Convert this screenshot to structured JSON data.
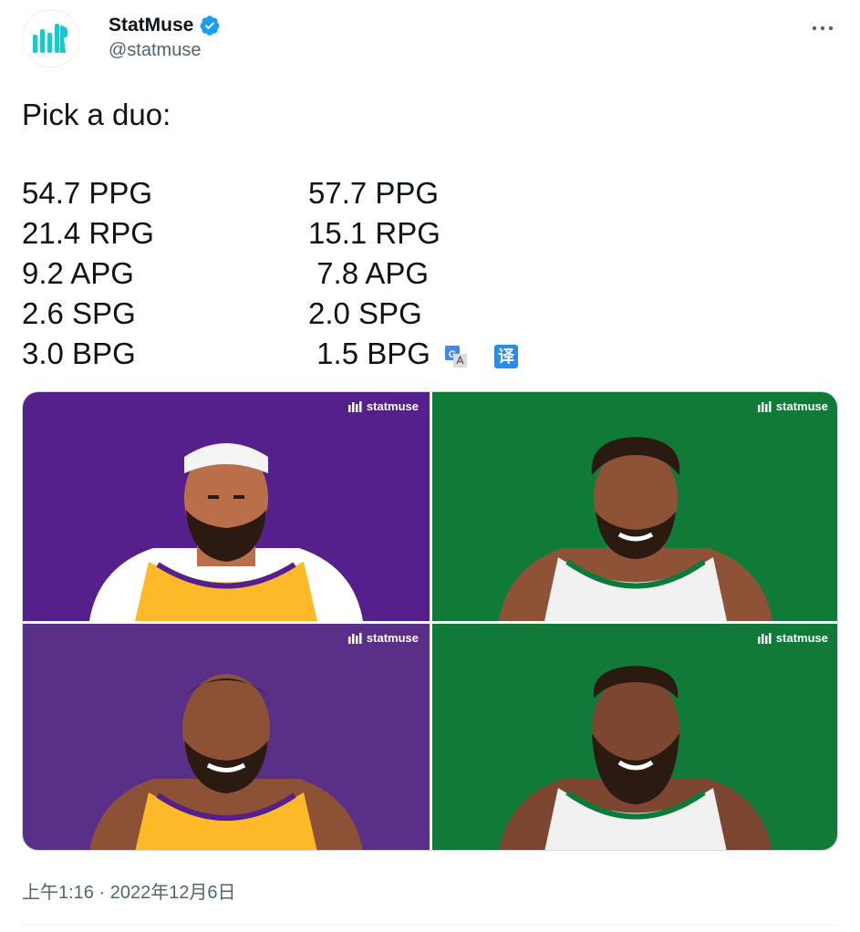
{
  "author": {
    "display_name": "StatMuse",
    "handle": "@statmuse",
    "verified_icon": "verified-badge-icon",
    "avatar_icon": "statmuse-logo-icon"
  },
  "tweet": {
    "text": "Pick a duo:",
    "stats": [
      {
        "left": "54.7 PPG",
        "right": "57.7 PPG"
      },
      {
        "left": "21.4 RPG",
        "right": "15.1 RPG"
      },
      {
        "left": "9.2 APG",
        "right": " 7.8 APG"
      },
      {
        "left": "2.6 SPG",
        "right": "2.0 SPG"
      },
      {
        "left": "3.0 BPG",
        "right": " 1.5 BPG"
      }
    ],
    "translate_glyph": "译"
  },
  "media": {
    "watermark": "statmuse",
    "tiles": [
      {
        "team_color": "#55208b",
        "jersey": "#fdb927",
        "trim": "#55208b",
        "skin": "#b86f4a"
      },
      {
        "team_color": "#107a37",
        "jersey": "#f1f1f1",
        "trim": "#0b7a3a",
        "skin": "#8e5236"
      },
      {
        "team_color": "#5a2f87",
        "jersey": "#fdb927",
        "trim": "#55208b",
        "skin": "#8d5136"
      },
      {
        "team_color": "#117a38",
        "jersey": "#f1f1f1",
        "trim": "#0b7a3a",
        "skin": "#7c4630"
      }
    ]
  },
  "timestamp": "上午1:16 · 2022年12月6日",
  "colors": {
    "text": "#0f1419",
    "secondary": "#536471",
    "verified": "#1d9bf0",
    "brand": "#1ec8c8"
  }
}
